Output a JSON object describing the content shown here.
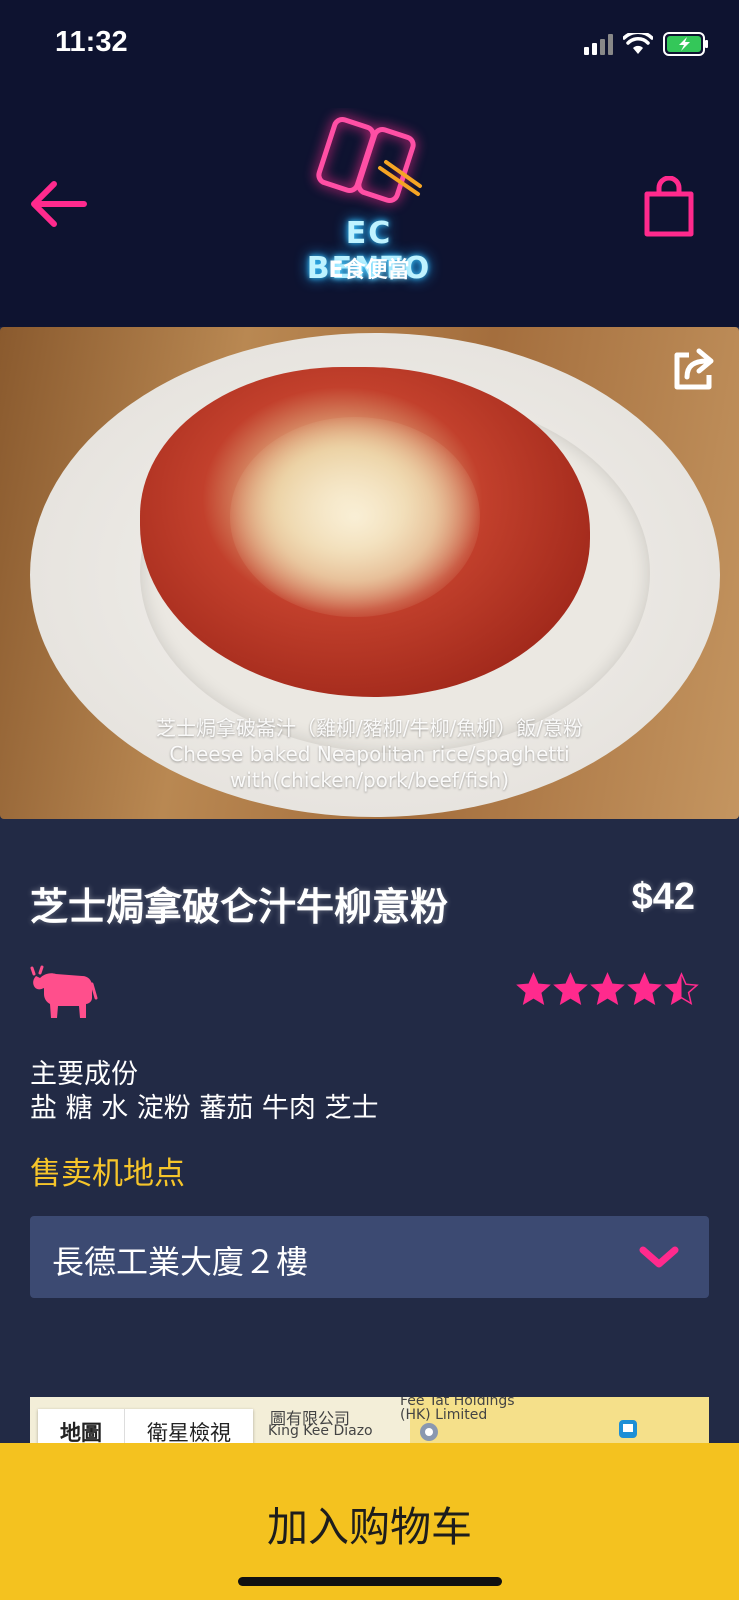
{
  "status_bar": {
    "time": "11:32"
  },
  "header": {
    "back_icon": "arrow-left-icon",
    "cart_icon": "shopping-bag-icon",
    "logo_title": "EC BENTO",
    "logo_subtitle": "E食便當"
  },
  "photo": {
    "share_icon": "share-icon",
    "caption_lines": [
      "芝士焗拿破崙汁（雞柳/豬柳/牛柳/魚柳）飯/意粉",
      "Cheese baked Neapolitan rice/spaghetti",
      "with(chicken/pork/beef/fish)"
    ]
  },
  "product": {
    "name": "芝士焗拿破仑汁牛柳意粉",
    "price": "$42",
    "meat_icon": "cow-icon",
    "rating": 4.5,
    "rating_max": 5
  },
  "ingredients": {
    "label": "主要成份",
    "list": "盐 糖 水 淀粉 蕃茄 牛肉 芝士"
  },
  "location": {
    "label": "售卖机地点",
    "selected": "長德工業大廈２樓"
  },
  "map": {
    "tabs": [
      "地圖",
      "衛星檢視"
    ],
    "labels": [
      "Fee Tat Holdings",
      "(HK) Limited",
      "King Kee Diazo",
      "圖有限公司"
    ]
  },
  "cart": {
    "label": "加入购物车"
  },
  "colors": {
    "accent_pink": "#ff2a8d",
    "accent_yellow": "#f4c21f",
    "header_bg": "#0e1330",
    "body_bg": "#222a45"
  }
}
